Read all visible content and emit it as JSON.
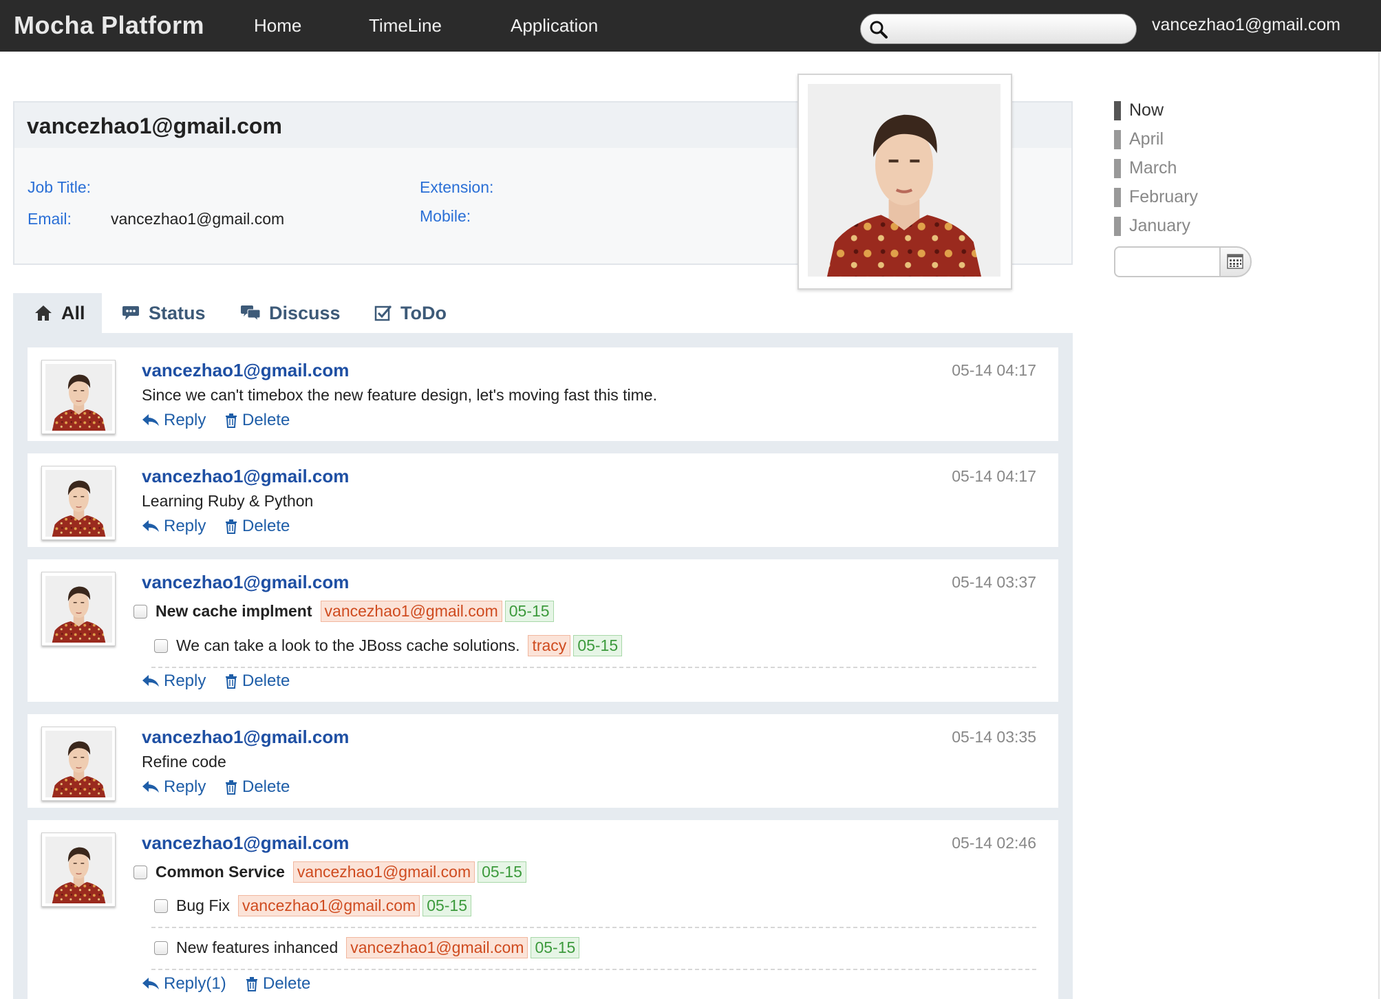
{
  "header": {
    "brand": "Mocha Platform",
    "nav": [
      "Home",
      "TimeLine",
      "Application"
    ],
    "search": {
      "value": "",
      "placeholder": ""
    },
    "current_user": "vancezhao1@gmail.com"
  },
  "profile": {
    "name": "vancezhao1@gmail.com",
    "job_title_label": "Job Title:",
    "job_title": "",
    "email_label": "Email:",
    "email": "vancezhao1@gmail.com",
    "extension_label": "Extension:",
    "extension": "",
    "mobile_label": "Mobile:",
    "mobile": ""
  },
  "timeline": {
    "items": [
      "Now",
      "April",
      "March",
      "February",
      "January"
    ],
    "active": "Now",
    "date_value": ""
  },
  "tabs": [
    {
      "label": "All",
      "icon": "home-icon"
    },
    {
      "label": "Status",
      "icon": "speech-bubble-icon"
    },
    {
      "label": "Discuss",
      "icon": "discussion-icon"
    },
    {
      "label": "ToDo",
      "icon": "checkbox-icon"
    }
  ],
  "actions": {
    "reply": "Reply",
    "delete": "Delete",
    "reply_count": "Reply(1)"
  },
  "posts": [
    {
      "author": "vancezhao1@gmail.com",
      "time": "05-14 04:17",
      "text": "Since we can't timebox the new feature design, let's moving fast this time."
    },
    {
      "author": "vancezhao1@gmail.com",
      "time": "05-14 04:17",
      "text": "Learning Ruby & Python"
    },
    {
      "author": "vancezhao1@gmail.com",
      "time": "05-14 03:37",
      "todo": {
        "title": "New cache implment",
        "assignee": "vancezhao1@gmail.com",
        "due": "05-15"
      },
      "subtasks": [
        {
          "title": "We can take a look to the JBoss cache solutions.",
          "assignee": "tracy",
          "due": "05-15"
        }
      ]
    },
    {
      "author": "vancezhao1@gmail.com",
      "time": "05-14 03:35",
      "text": "Refine code"
    },
    {
      "author": "vancezhao1@gmail.com",
      "time": "05-14 02:46",
      "todo": {
        "title": "Common Service",
        "assignee": "vancezhao1@gmail.com",
        "due": "05-15"
      },
      "subtasks": [
        {
          "title": "Bug Fix",
          "assignee": "vancezhao1@gmail.com",
          "due": "05-15"
        },
        {
          "title": "New features inhanced",
          "assignee": "vancezhao1@gmail.com",
          "due": "05-15"
        }
      ]
    }
  ],
  "colors": {
    "topbar": "#2b2b2b",
    "link_blue": "#1e4fa3",
    "label_blue": "#2a6fd6",
    "tag_user_bg": "#fbe3d8",
    "tag_user_text": "#cf4b1f",
    "tag_date_bg": "#e6f5e6",
    "tag_date_text": "#3c9a3c"
  }
}
